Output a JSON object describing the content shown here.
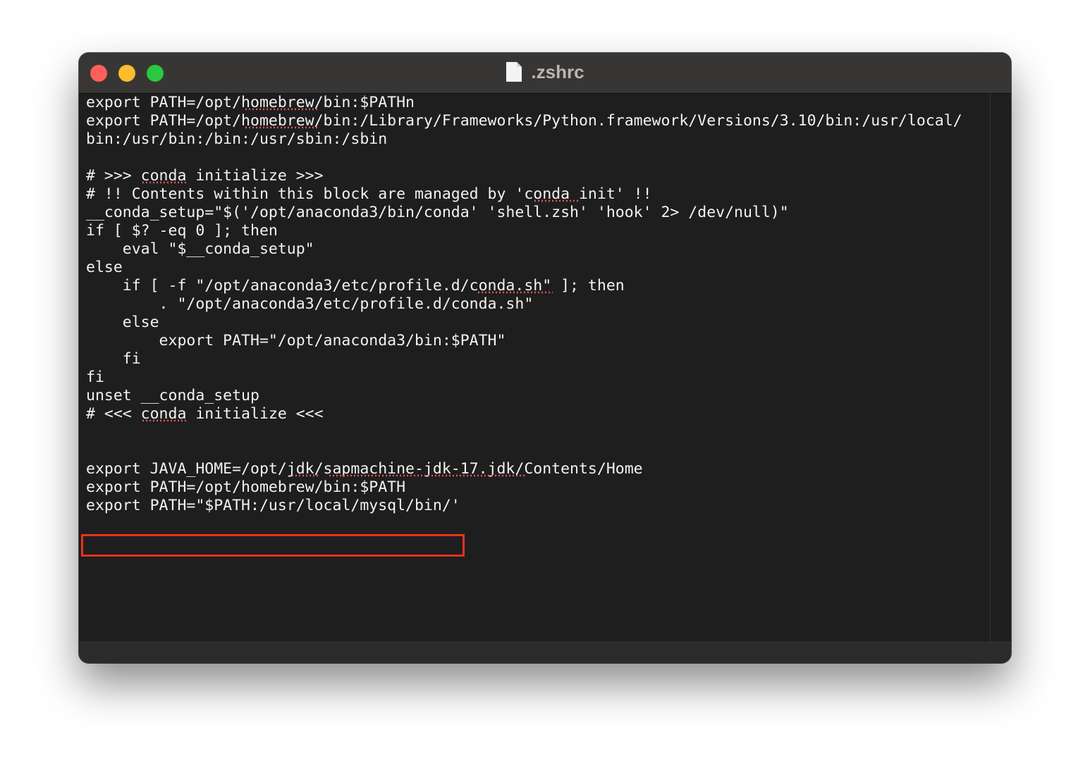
{
  "window": {
    "title": ".zshrc",
    "title_icon": "document-icon"
  },
  "editor": {
    "lines": [
      "export PATH=/opt/homebrew/bin:$PATHn",
      "export PATH=/opt/homebrew/bin:/Library/Frameworks/Python.framework/Versions/3.10/bin:/usr/local/",
      "bin:/usr/bin:/bin:/usr/sbin:/sbin",
      "",
      "# >>> conda initialize >>>",
      "# !! Contents within this block are managed by 'conda init' !!",
      "__conda_setup=\"$('/opt/anaconda3/bin/conda' 'shell.zsh' 'hook' 2> /dev/null)\"",
      "if [ $? -eq 0 ]; then",
      "    eval \"$__conda_setup\"",
      "else",
      "    if [ -f \"/opt/anaconda3/etc/profile.d/conda.sh\" ]; then",
      "        . \"/opt/anaconda3/etc/profile.d/conda.sh\"",
      "    else",
      "        export PATH=\"/opt/anaconda3/bin:$PATH\"",
      "    fi",
      "fi",
      "unset __conda_setup",
      "# <<< conda initialize <<<",
      "",
      "",
      "export JAVA_HOME=/opt/jdk/sapmachine-jdk-17.jdk/Contents/Home",
      "export PATH=/opt/homebrew/bin:$PATH",
      "export PATH=\"$PATH:/usr/local/mysql/bin/'"
    ],
    "highlighted_line": 22
  },
  "colors": {
    "editor_bg": "#1e1e1e",
    "titlebar_bg": "#383634",
    "text": "#f2f2f2",
    "highlight_border": "#e8321e",
    "spellcheck_underline": "#e0575b"
  }
}
